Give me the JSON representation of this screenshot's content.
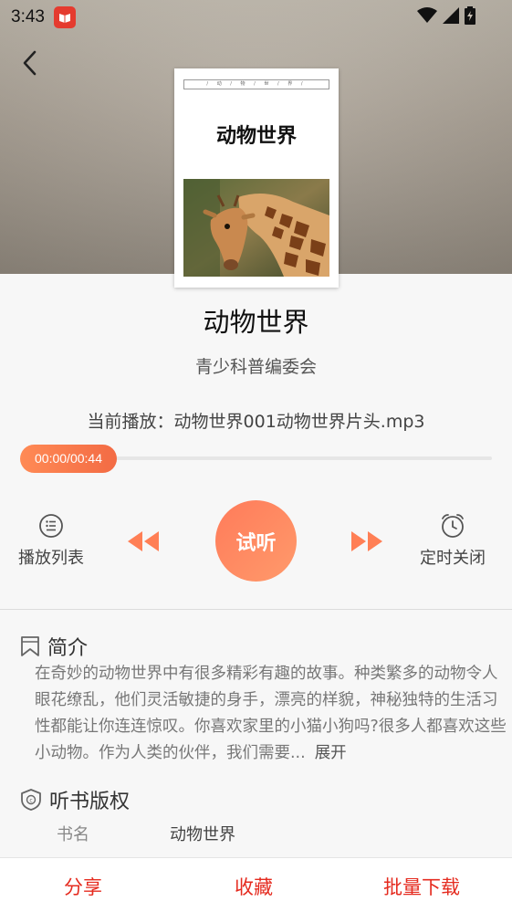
{
  "status_bar": {
    "time": "3:43"
  },
  "cover": {
    "band_text": "/ 动 / 物 / 世 / 界 /",
    "title": "动物世界"
  },
  "book": {
    "title": "动物世界",
    "author": "青少科普编委会"
  },
  "player": {
    "now_playing": "当前播放：动物世界001动物世界片头.mp3",
    "time": "00:00/00:44",
    "progress": 0,
    "playlist_label": "播放列表",
    "play_label": "试听",
    "timer_label": "定时关闭"
  },
  "intro": {
    "heading": "简介",
    "text": "在奇妙的动物世界中有很多精彩有趣的故事。种类繁多的动物令人眼花缭乱，他们灵活敏捷的身手，漂亮的样貌，神秘独特的生活习性都能让你连连惊叹。你喜欢家里的小猫小狗吗?很多人都喜欢这些小动物。作为人类的伙伴，我们需要...",
    "expand_label": "展开"
  },
  "copyright": {
    "heading": "听书版权",
    "field_label": "书名",
    "field_value": "动物世界"
  },
  "bottom_bar": {
    "share": "分享",
    "favorite": "收藏",
    "batch_download": "批量下载"
  },
  "colors": {
    "accent": "#ff7b5a",
    "bottom_text": "#e52b1f"
  }
}
